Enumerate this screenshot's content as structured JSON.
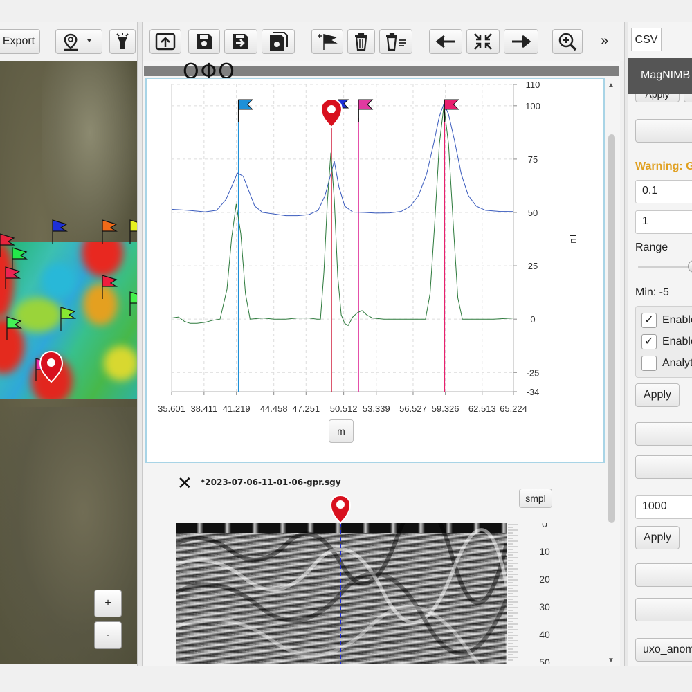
{
  "map_toolbar": {
    "export_label": "Export"
  },
  "map": {
    "zoom_in_label": "+",
    "zoom_out_label": "-",
    "flags": [
      {
        "color": "#1d2fd8"
      },
      {
        "color": "#f06a18"
      },
      {
        "color": "#e6f020"
      },
      {
        "color": "#e8243c"
      },
      {
        "color": "#23e84a"
      },
      {
        "color": "#ea2452"
      },
      {
        "color": "#ee1e3e"
      },
      {
        "color": "#44f04c"
      },
      {
        "color": "#88e832"
      },
      {
        "color": "#ea2ea8"
      },
      {
        "color": "#44f054"
      }
    ]
  },
  "center_toolbar": {
    "expand_label": "»"
  },
  "status_symbols": "ΟΦΟ",
  "chart_unit_button": "m",
  "chart_data": {
    "type": "line",
    "xlabel": "m",
    "ylabel": "nT",
    "x_ticks": [
      "35.601",
      "38.411",
      "41.219",
      "44.458",
      "47.251",
      "50.512",
      "53.339",
      "56.527",
      "59.326",
      "62.513",
      "65.224"
    ],
    "y_ticks": [
      "110",
      "100",
      "75",
      "50",
      "25",
      "0",
      "-25",
      "-34"
    ],
    "xlim": [
      35.601,
      65.224
    ],
    "ylim": [
      -34,
      110
    ],
    "grid": true,
    "series": [
      {
        "color": "#3a5bbd",
        "points": [
          [
            35.6,
            51.5
          ],
          [
            37,
            51
          ],
          [
            38.5,
            50.3
          ],
          [
            39.5,
            51
          ],
          [
            40.3,
            56
          ],
          [
            40.8,
            62
          ],
          [
            41.3,
            68.5
          ],
          [
            41.8,
            67
          ],
          [
            42.3,
            60
          ],
          [
            42.8,
            53
          ],
          [
            43.5,
            50
          ],
          [
            44.5,
            49.3
          ],
          [
            45.5,
            48.5
          ],
          [
            46.5,
            48.5
          ],
          [
            47.5,
            49
          ],
          [
            48.3,
            51
          ],
          [
            48.9,
            58
          ],
          [
            49.3,
            66
          ],
          [
            49.7,
            74
          ],
          [
            50.1,
            62
          ],
          [
            50.6,
            53
          ],
          [
            51.3,
            50.2
          ],
          [
            52.3,
            50
          ],
          [
            53.3,
            49.7
          ],
          [
            54.5,
            49.8
          ],
          [
            55.5,
            50.5
          ],
          [
            56.3,
            53
          ],
          [
            57,
            58
          ],
          [
            57.7,
            68
          ],
          [
            58.3,
            82
          ],
          [
            58.8,
            95
          ],
          [
            59.2,
            101
          ],
          [
            59.6,
            96
          ],
          [
            60.1,
            84
          ],
          [
            60.7,
            68
          ],
          [
            61.3,
            58
          ],
          [
            62,
            53
          ],
          [
            62.8,
            51
          ],
          [
            64,
            50.5
          ],
          [
            65.2,
            50.4
          ]
        ]
      },
      {
        "color": "#2d7a3c",
        "points": [
          [
            35.6,
            0.5
          ],
          [
            36.2,
            1
          ],
          [
            36.7,
            -1
          ],
          [
            37.2,
            -2
          ],
          [
            37.8,
            -2
          ],
          [
            38.5,
            -1.5
          ],
          [
            39.2,
            -0.5
          ],
          [
            39.8,
            0
          ],
          [
            40.4,
            14
          ],
          [
            40.8,
            38
          ],
          [
            41.2,
            54
          ],
          [
            41.6,
            40
          ],
          [
            42.0,
            12
          ],
          [
            42.4,
            0
          ],
          [
            43.5,
            0.5
          ],
          [
            44.5,
            0
          ],
          [
            45.5,
            0
          ],
          [
            46.5,
            0.5
          ],
          [
            47.5,
            0.5
          ],
          [
            48.2,
            0
          ],
          [
            48.5,
            0
          ],
          [
            48.8,
            22
          ],
          [
            49.1,
            55
          ],
          [
            49.4,
            78
          ],
          [
            49.7,
            56
          ],
          [
            50.0,
            20
          ],
          [
            50.3,
            2
          ],
          [
            50.6,
            -2
          ],
          [
            50.9,
            -3
          ],
          [
            51.3,
            1
          ],
          [
            51.7,
            3
          ],
          [
            52.1,
            4
          ],
          [
            52.5,
            2
          ],
          [
            53,
            0.5
          ],
          [
            54,
            0
          ],
          [
            55,
            0
          ],
          [
            56,
            0
          ],
          [
            57,
            0
          ],
          [
            57.6,
            0
          ],
          [
            58,
            12
          ],
          [
            58.4,
            45
          ],
          [
            58.8,
            82
          ],
          [
            59.2,
            100
          ],
          [
            59.6,
            82
          ],
          [
            60,
            45
          ],
          [
            60.4,
            10
          ],
          [
            60.8,
            0
          ],
          [
            62,
            0
          ],
          [
            63.5,
            0
          ],
          [
            65.2,
            0.5
          ]
        ]
      }
    ],
    "markers": [
      {
        "x": 41.4,
        "color": "#1e90d8"
      },
      {
        "x": 49.45,
        "color": "#cc1030"
      },
      {
        "x": 51.8,
        "color": "#e03aa0"
      },
      {
        "x": 59.25,
        "color": "#e8206e"
      }
    ]
  },
  "gpr": {
    "filename": "*2023-07-06-11-01-06-gpr.sgy",
    "unit_label": "smpl",
    "depth_ticks": [
      "0",
      "10",
      "20",
      "30",
      "40",
      "50"
    ]
  },
  "right_panel": {
    "tab_csv": "CSV",
    "tooltip": "MagNIMB",
    "apply_top": "Apply",
    "warning": "Warning: G",
    "input1": "0.1",
    "input2": "1",
    "range_label": "Range",
    "min_label": "Min: -5",
    "checkboxes": [
      {
        "label": "Enable",
        "checked": true
      },
      {
        "label": "Enable",
        "checked": true
      },
      {
        "label": "Analyt",
        "checked": false
      }
    ],
    "apply_1": "Apply",
    "input3": "1000",
    "apply_2": "Apply",
    "bottom_button": "uxo_anom"
  }
}
